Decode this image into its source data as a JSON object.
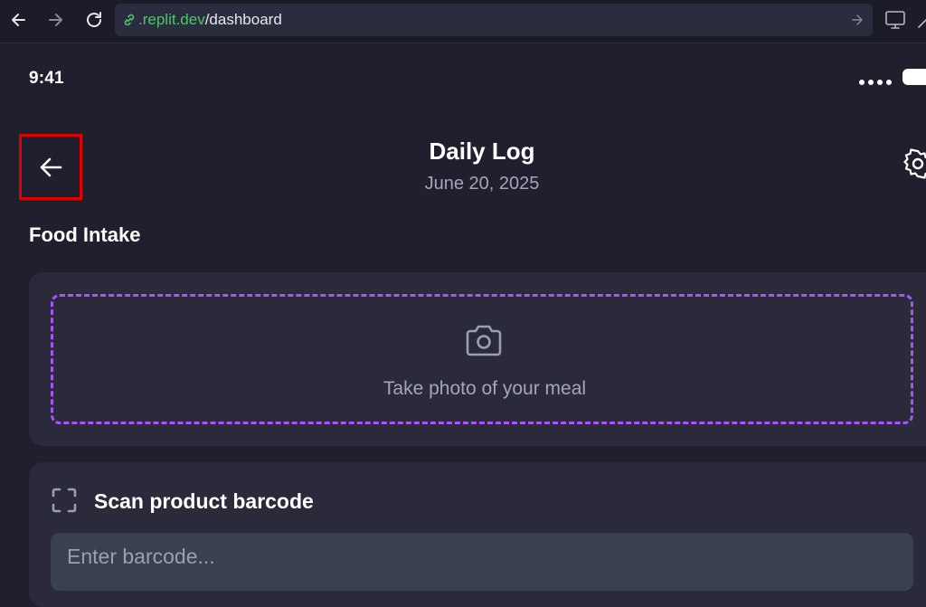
{
  "browser": {
    "url_host": ".replit.dev",
    "url_path": "/dashboard"
  },
  "status_bar": {
    "time": "9:41"
  },
  "header": {
    "title": "Daily Log",
    "date": "June 20, 2025"
  },
  "food_intake": {
    "section_title": "Food Intake",
    "photo_label": "Take photo of your meal",
    "scan_title": "Scan product barcode",
    "barcode_placeholder": "Enter barcode..."
  },
  "colors": {
    "background": "#1f1f2d",
    "card": "#2a2a3b",
    "accent_dashed": "#a855f7",
    "highlight_box": "#e00000",
    "url_host": "#4ec46a"
  },
  "icons": [
    "back-arrow-icon",
    "forward-arrow-icon",
    "reload-icon",
    "link-icon",
    "go-arrow-icon",
    "monitor-icon",
    "gear-icon",
    "camera-icon",
    "scan-frame-icon"
  ]
}
